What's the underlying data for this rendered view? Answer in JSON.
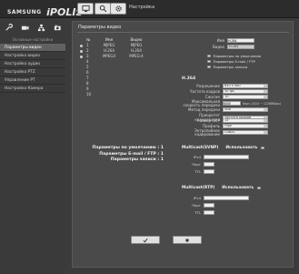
{
  "header": {
    "logo_brand": "SAMSUNG",
    "logo_product": "iPOLIS",
    "settings_label": "Настройка"
  },
  "sidebar": {
    "subtitle": "Основные настройки",
    "items": [
      {
        "label": "Параметры видео",
        "active": true
      },
      {
        "label": "Настройка видео",
        "active": false
      },
      {
        "label": "Настройка аудио",
        "active": false
      },
      {
        "label": "Настройка PTZ",
        "active": false
      },
      {
        "label": "Управление PT",
        "active": false
      },
      {
        "label": "Настройка Камера",
        "active": false
      }
    ]
  },
  "panel": {
    "title": "Параметры видео",
    "table": {
      "headers": [
        "№",
        "Имя",
        "Видео"
      ],
      "rows": [
        {
          "no": "1",
          "name": "MJPEG",
          "video": "MJPEG"
        },
        {
          "no": "2",
          "name": "H.264",
          "video": "H.264"
        },
        {
          "no": "3",
          "name": "MPEG4",
          "video": "MPEG-4"
        },
        {
          "no": "4",
          "name": "",
          "video": ""
        },
        {
          "no": "5",
          "name": "",
          "video": ""
        },
        {
          "no": "6",
          "name": "",
          "video": ""
        },
        {
          "no": "7",
          "name": "",
          "video": ""
        },
        {
          "no": "8",
          "name": "",
          "video": ""
        },
        {
          "no": "9",
          "name": "",
          "video": ""
        },
        {
          "no": "10",
          "name": "",
          "video": ""
        }
      ]
    },
    "default_labels": [
      "Параметры по умолчанию : 1",
      "Параметры E-mail / FTP : 1",
      "Параметры записи : 1"
    ],
    "right": {
      "name_label": "Имя",
      "name_value": "H.264",
      "video_label": "Видео",
      "video_value": "H.264",
      "checks": [
        "Параметры по умолчанию",
        "Параметры E-mail / FTP",
        "Параметры записи"
      ],
      "h264_title": "H.264",
      "fields": [
        {
          "label": "Разрешение",
          "value": "640 x 480"
        },
        {
          "label": "Частота кадров",
          "value": "30 fps"
        },
        {
          "label": "Сжатие",
          "value": "10"
        },
        {
          "label": "Максимальная скорость передачи",
          "value": "6000"
        },
        {
          "label": "Метод передачи",
          "value": "VBR"
        },
        {
          "label": "Приоритет кодирования",
          "value": "Частота кадров"
        },
        {
          "label": "Размер GOP",
          "value": "15"
        },
        {
          "label": "Профиль",
          "value": "High"
        },
        {
          "label": "Энтропийное кодирование",
          "value": "CABAC"
        }
      ],
      "bitrate_note": "Kbps (1024 ~ 12288Kbps)"
    },
    "multicast_svnp": {
      "title": "Multicast(SVNP)",
      "use_label": "Использовать",
      "ip_label": "IPv4",
      "port_label": "Порт",
      "ttl_label": "TTL"
    },
    "multicast_rtp": {
      "title": "Multicast(RTP)",
      "use_label": "Использовать",
      "ip_label": "IPv4",
      "port_label": "Порт",
      "ttl_label": "TTL"
    }
  },
  "colors": {
    "background": "#3b3b3b",
    "panel": "#4a4a4a",
    "active_item": "#616161"
  }
}
